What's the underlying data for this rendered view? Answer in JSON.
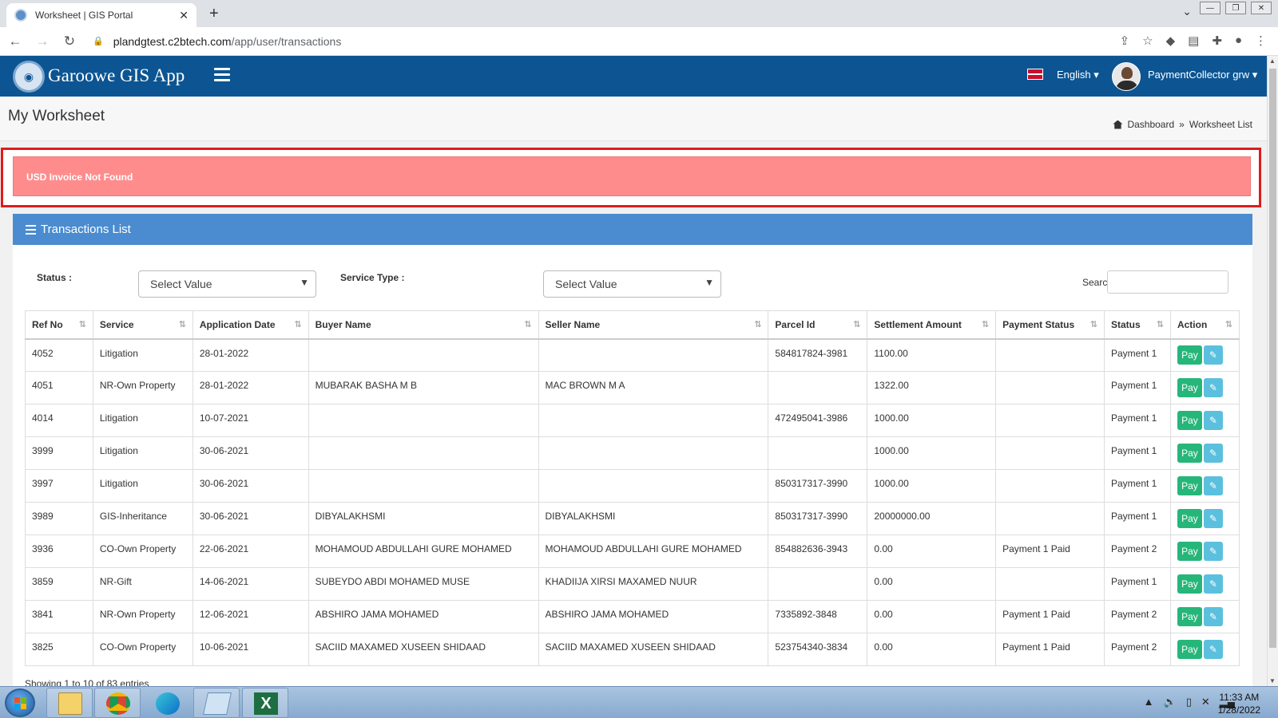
{
  "browser": {
    "tab_title": "Worksheet | GIS Portal",
    "url_host": "plandgtest.c2btech.com",
    "url_path": "/app/user/transactions"
  },
  "header": {
    "app_name": "Garoowe GIS App",
    "language": "English ▾",
    "user_name": "PaymentCollector grw ▾"
  },
  "page": {
    "title": "My Worksheet",
    "breadcrumb": [
      "Dashboard",
      "»",
      "Worksheet List"
    ]
  },
  "alert": {
    "message": "USD Invoice Not Found"
  },
  "panel": {
    "title": "Transactions List",
    "status_label": "Status :",
    "status_value": "Select Value",
    "service_label": "Service Type :",
    "service_value": "Select Value",
    "search_label": "Search:"
  },
  "table": {
    "columns": [
      "Ref No",
      "Service",
      "Application Date",
      "Buyer Name",
      "Seller Name",
      "Parcel Id",
      "Settlement Amount",
      "Payment Status",
      "Status",
      "Action"
    ],
    "pay_label": "Pay",
    "rows": [
      {
        "ref": "4052",
        "service": "Litigation",
        "date": "28-01-2022",
        "buyer": "",
        "seller": "",
        "parcel": "584817824-3981",
        "amount": "1100.00",
        "pstatus": "",
        "status": "Payment 1"
      },
      {
        "ref": "4051",
        "service": "NR-Own Property",
        "date": "28-01-2022",
        "buyer": "MUBARAK BASHA M B",
        "seller": "MAC BROWN M A",
        "parcel": "",
        "amount": "1322.00",
        "pstatus": "",
        "status": "Payment 1"
      },
      {
        "ref": "4014",
        "service": "Litigation",
        "date": "10-07-2021",
        "buyer": "",
        "seller": "",
        "parcel": "472495041-3986",
        "amount": "1000.00",
        "pstatus": "",
        "status": "Payment 1"
      },
      {
        "ref": "3999",
        "service": "Litigation",
        "date": "30-06-2021",
        "buyer": "",
        "seller": "",
        "parcel": "",
        "amount": "1000.00",
        "pstatus": "",
        "status": "Payment 1"
      },
      {
        "ref": "3997",
        "service": "Litigation",
        "date": "30-06-2021",
        "buyer": "",
        "seller": "",
        "parcel": "850317317-3990",
        "amount": "1000.00",
        "pstatus": "",
        "status": "Payment 1"
      },
      {
        "ref": "3989",
        "service": "GIS-Inheritance",
        "date": "30-06-2021",
        "buyer": "DIBYALAKHSMI",
        "seller": "DIBYALAKHSMI",
        "parcel": "850317317-3990",
        "amount": "20000000.00",
        "pstatus": "",
        "status": "Payment 1"
      },
      {
        "ref": "3936",
        "service": "CO-Own Property",
        "date": "22-06-2021",
        "buyer": "MOHAMOUD ABDULLAHI GURE MOHAMED",
        "seller": "MOHAMOUD ABDULLAHI GURE MOHAMED",
        "parcel": "854882636-3943",
        "amount": "0.00",
        "pstatus": "Payment 1 Paid",
        "status": "Payment 2"
      },
      {
        "ref": "3859",
        "service": "NR-Gift",
        "date": "14-06-2021",
        "buyer": "SUBEYDO ABDI MOHAMED MUSE",
        "seller": "KHADIIJA XIRSI MAXAMED NUUR",
        "parcel": "",
        "amount": "0.00",
        "pstatus": "",
        "status": "Payment 1"
      },
      {
        "ref": "3841",
        "service": "NR-Own Property",
        "date": "12-06-2021",
        "buyer": "ABSHIRO JAMA MOHAMED",
        "seller": "ABSHIRO JAMA MOHAMED",
        "parcel": "7335892-3848",
        "amount": "0.00",
        "pstatus": "Payment 1 Paid",
        "status": "Payment 2"
      },
      {
        "ref": "3825",
        "service": "CO-Own Property",
        "date": "10-06-2021",
        "buyer": "SACIID MAXAMED XUSEEN SHIDAAD",
        "seller": "SACIID MAXAMED XUSEEN SHIDAAD",
        "parcel": "523754340-3834",
        "amount": "0.00",
        "pstatus": "Payment 1 Paid",
        "status": "Payment 2"
      }
    ],
    "info": "Showing 1 to 10 of 83 entries"
  },
  "taskbar": {
    "time": "11:33 AM",
    "date": "1/28/2022"
  },
  "colors": {
    "header": "#0c5592",
    "panel": "#4a8ccf",
    "alert": "#ff8c8c",
    "pay": "#26b67a",
    "edit": "#5bc0de",
    "alert_border": "#e01b1b"
  }
}
